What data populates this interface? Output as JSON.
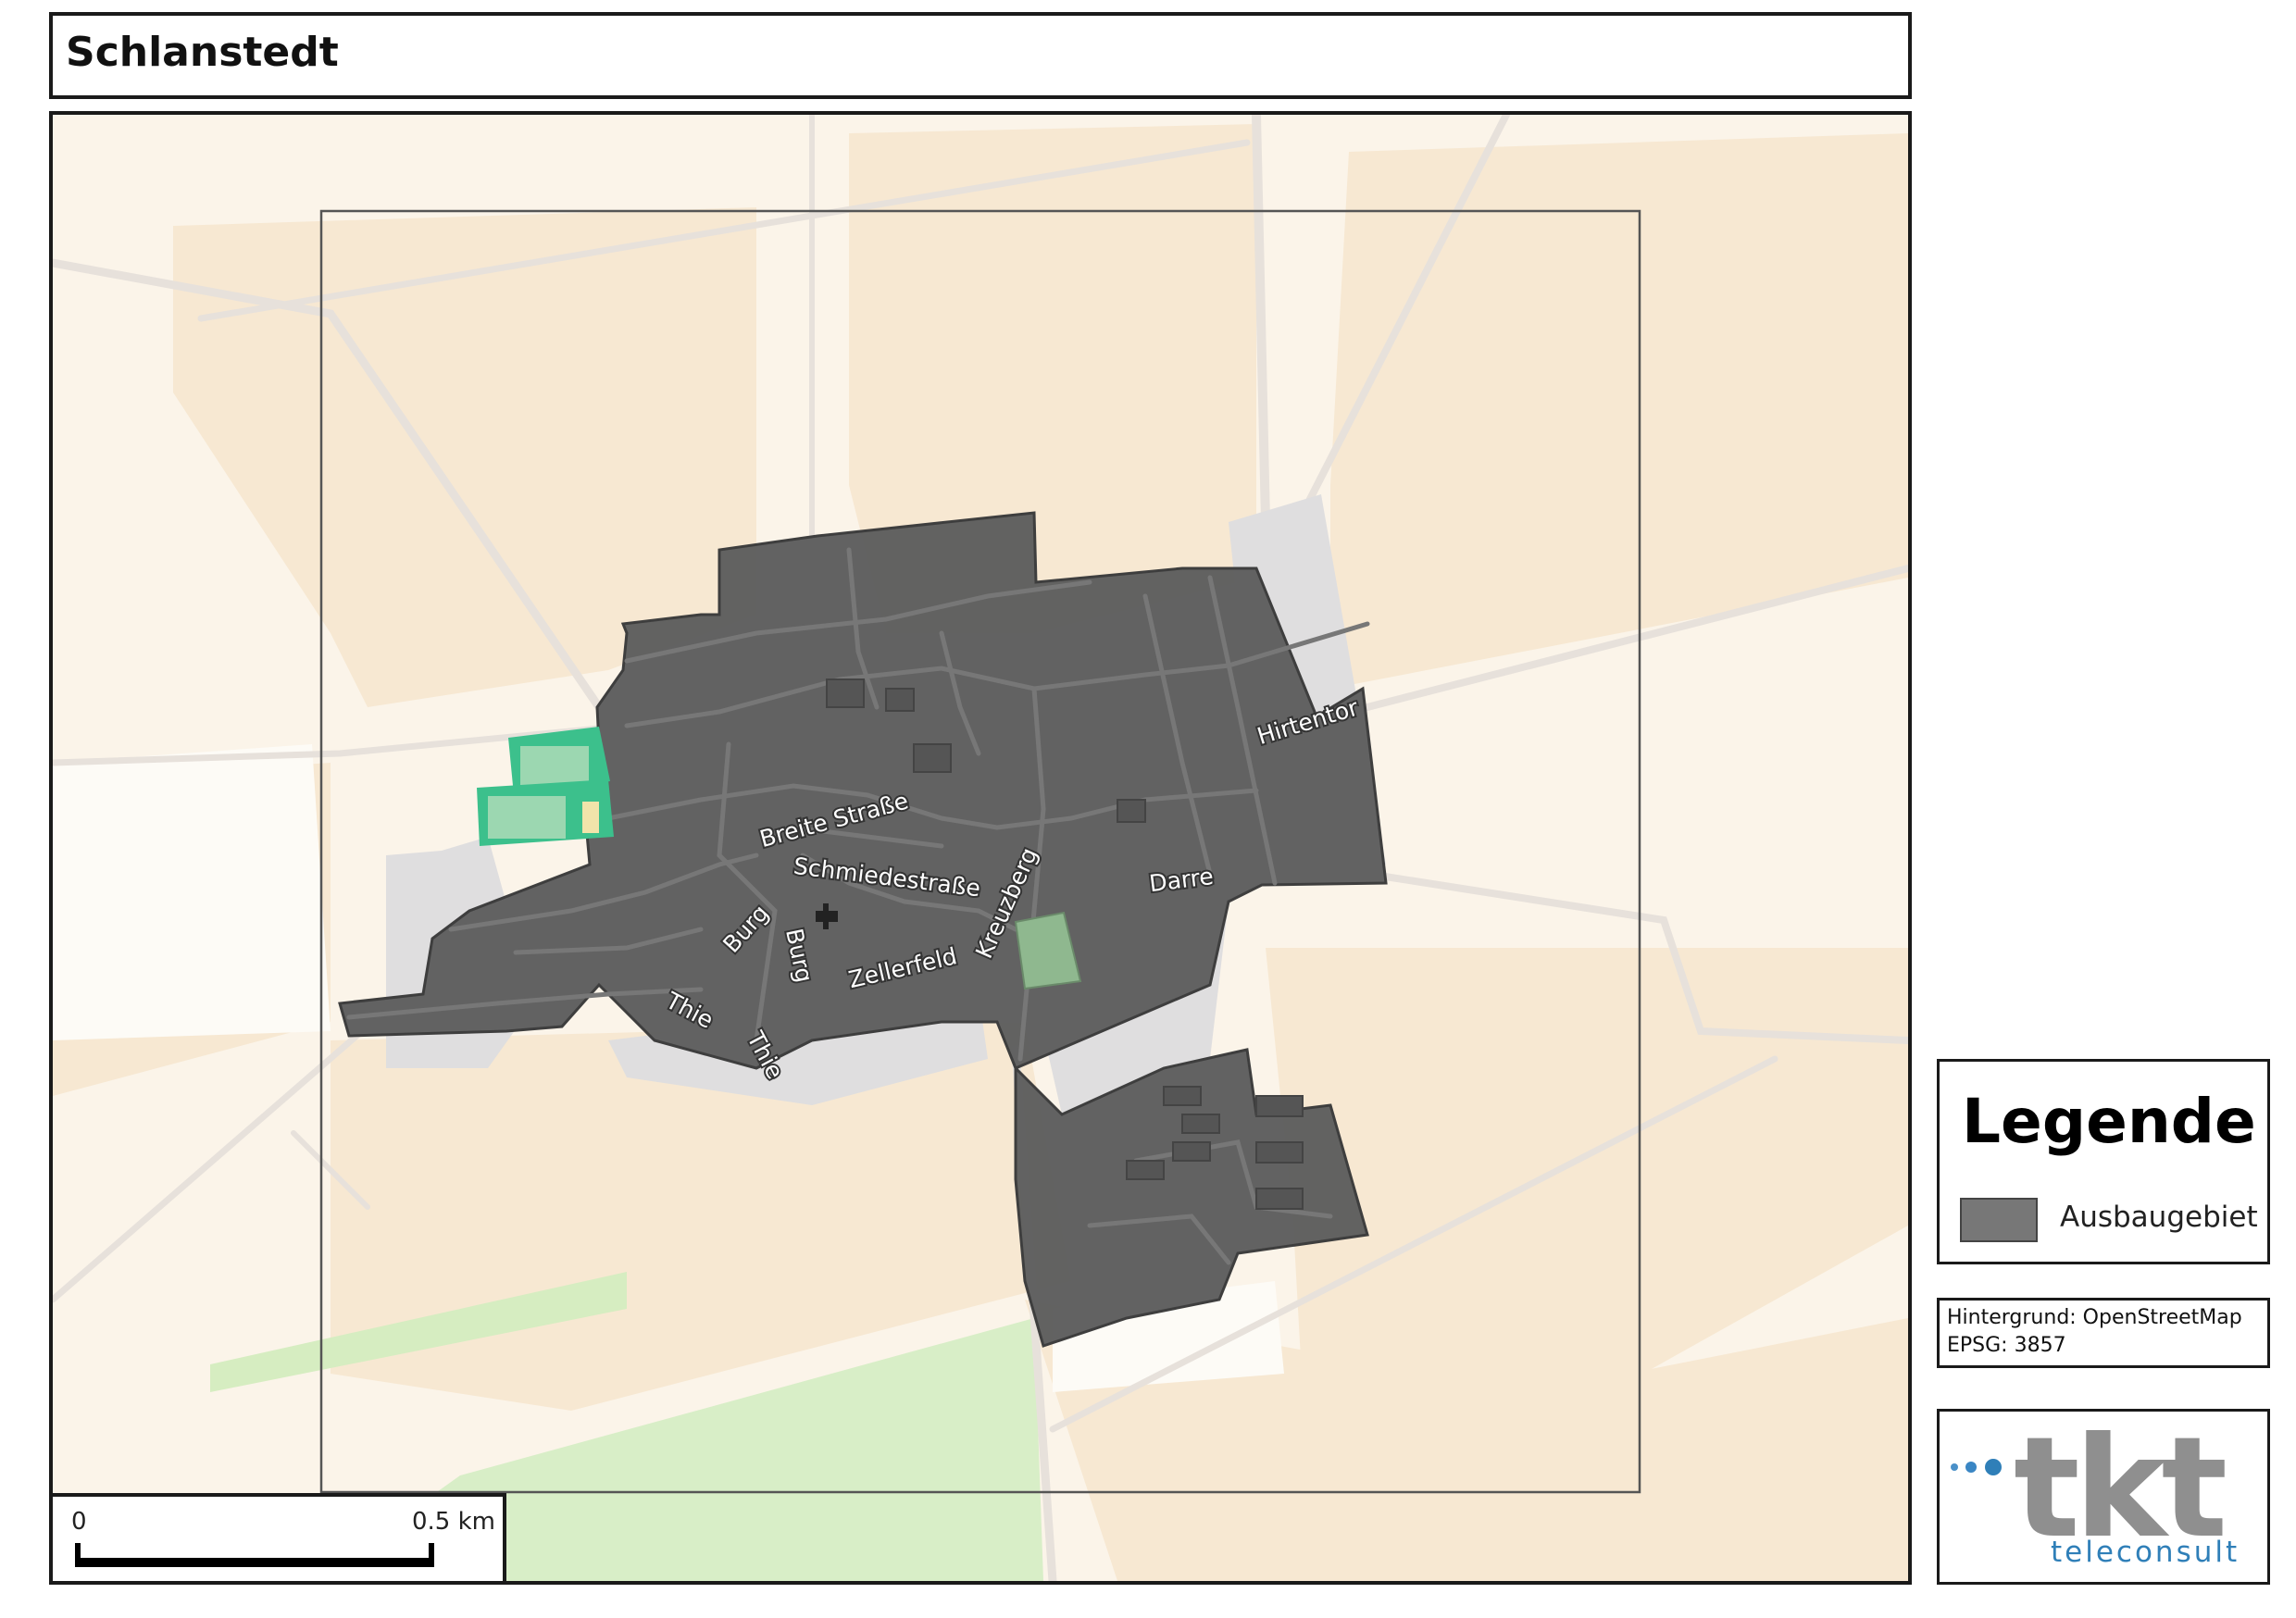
{
  "title": "Schlanstedt",
  "map": {
    "street_labels": [
      "Breite Straße",
      "Schmiedestraße",
      "Kreuzberg",
      "Hirtentor",
      "Darre",
      "Zellerfeld",
      "Burg",
      "Burg",
      "Thie",
      "Thie"
    ],
    "colors": {
      "background": "#fbf4e9",
      "farmland": "#f7e8d2",
      "ausbaugebiet": "#5e5e5e",
      "residential": "#dddcdd",
      "sports": "#3cc08c",
      "grass": "#cfeac0"
    }
  },
  "scalebar": {
    "start": "0",
    "end": "0.5 km"
  },
  "legend": {
    "heading": "Legende",
    "items": [
      {
        "label": "Ausbaugebiet",
        "color": "#777777"
      }
    ]
  },
  "info": {
    "line1": "Hintergrund: OpenStreetMap",
    "line2": "EPSG: 3857"
  },
  "logo": {
    "wordmark": "tkt",
    "subtitle": "teleconsult"
  }
}
